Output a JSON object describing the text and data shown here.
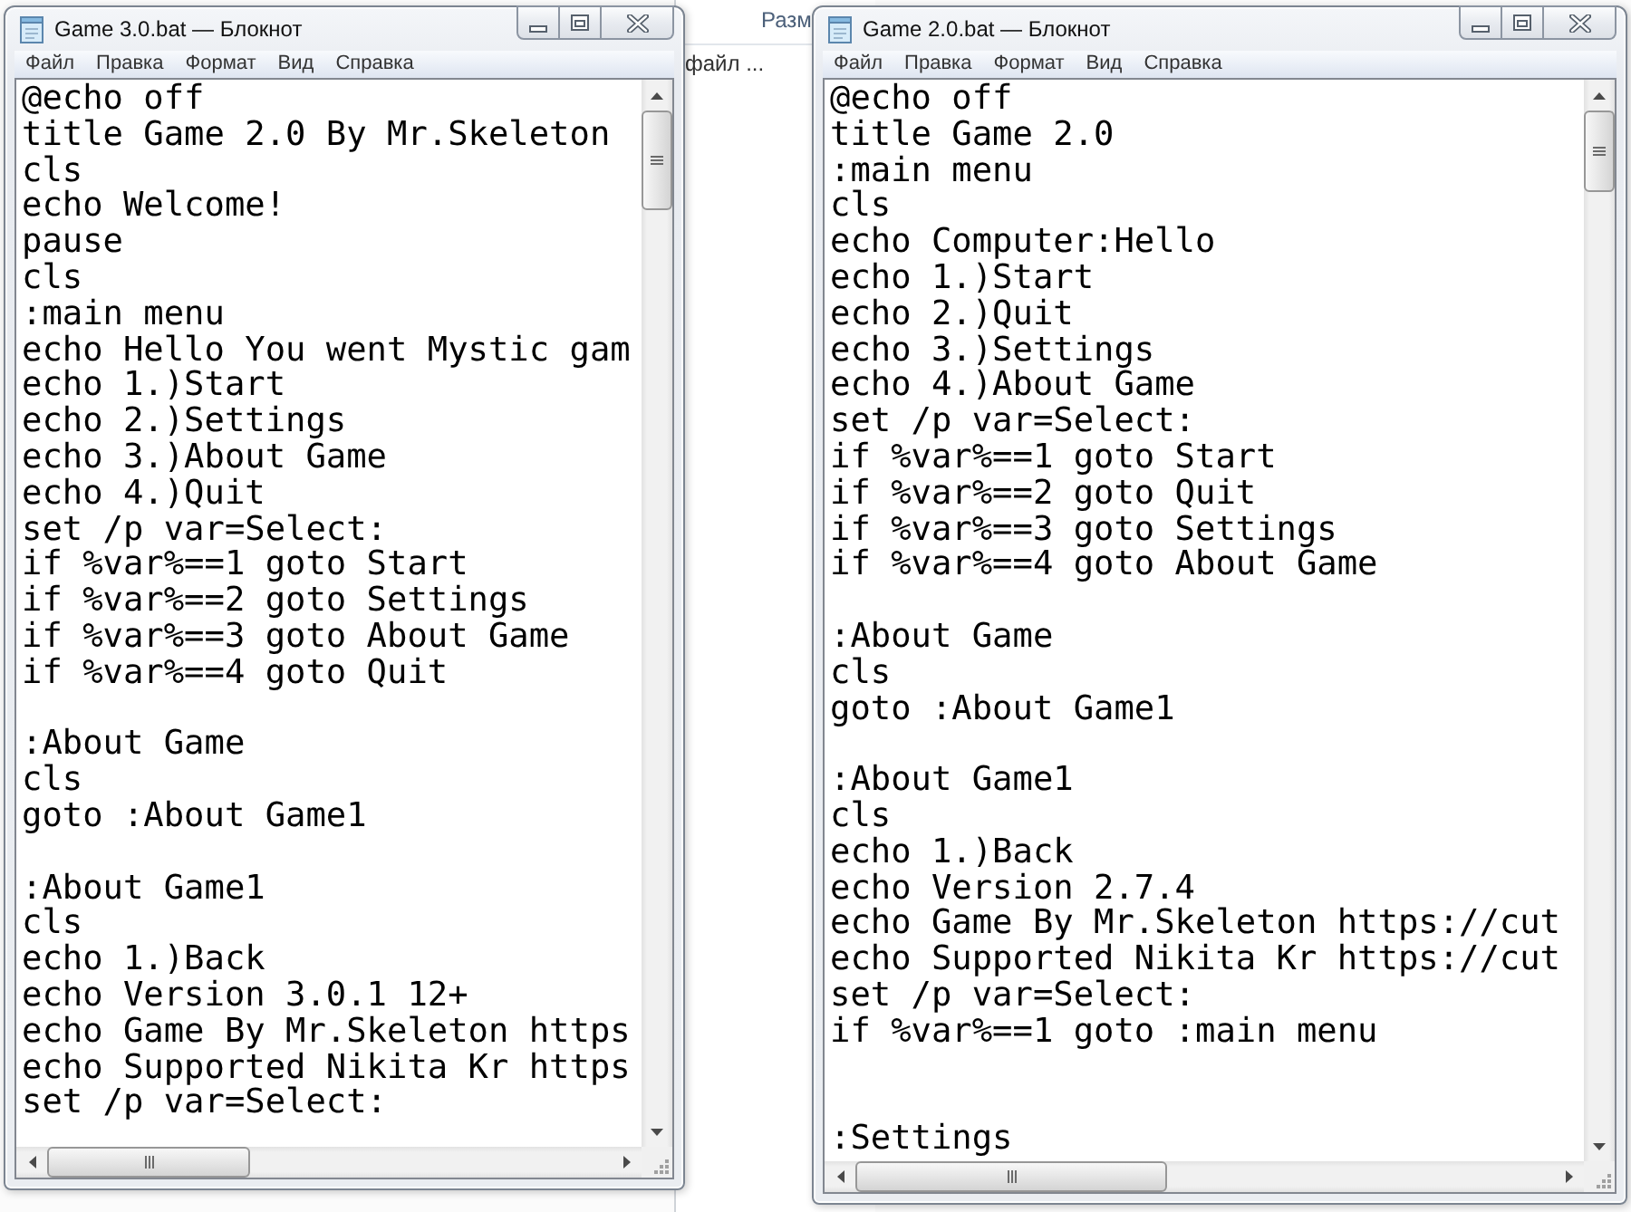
{
  "background_window": {
    "column_header": "Разм",
    "cell": "файл ..."
  },
  "windows": [
    {
      "title": "Game 3.0.bat — Блокнот",
      "menu": [
        "Файл",
        "Правка",
        "Формат",
        "Вид",
        "Справка"
      ],
      "text": "@echo off\ntitle Game 2.0 By Mr.Skeleton\ncls\necho Welcome!\npause\ncls\n:main menu\necho Hello You went Mystic gam\necho 1.)Start\necho 2.)Settings\necho 3.)About Game\necho 4.)Quit\nset /p var=Select:\nif %var%==1 goto Start\nif %var%==2 goto Settings\nif %var%==3 goto About Game\nif %var%==4 goto Quit\n\n:About Game\ncls\ngoto :About Game1\n\n:About Game1\ncls\necho 1.)Back\necho Version 3.0.1 12+\necho Game By Mr.Skeleton https\necho Supported Nikita Kr https\nset /p var=Select:"
    },
    {
      "title": "Game 2.0.bat — Блокнот",
      "menu": [
        "Файл",
        "Правка",
        "Формат",
        "Вид",
        "Справка"
      ],
      "text": "@echo off\ntitle Game 2.0\n:main menu\ncls\necho Computer:Hello\necho 1.)Start\necho 2.)Quit\necho 3.)Settings\necho 4.)About Game\nset /p var=Select:\nif %var%==1 goto Start\nif %var%==2 goto Quit\nif %var%==3 goto Settings\nif %var%==4 goto About Game\n\n:About Game\ncls\ngoto :About Game1\n\n:About Game1\ncls\necho 1.)Back\necho Version 2.7.4\necho Game By Mr.Skeleton https://cut\necho Supported Nikita Kr https://cut\nset /p var=Select:\nif %var%==1 goto :main menu\n\n\n:Settings"
    }
  ]
}
